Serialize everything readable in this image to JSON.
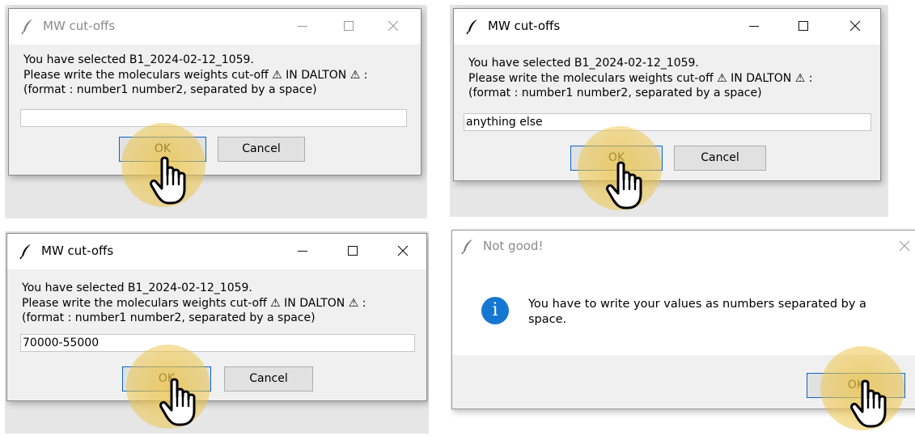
{
  "dialog_title": "MW cut-offs",
  "prompt": {
    "line1": "You have selected B1_2024-02-12_1059.",
    "line2": " Please write the moleculars weights cut-off ⚠ IN DALTON ⚠ :",
    "line3": "(format : number1 number2, separated by a space)"
  },
  "ok_label": "OK",
  "cancel_label": "Cancel",
  "panel1": {
    "entry_value": ""
  },
  "panel2": {
    "entry_value": "anything else"
  },
  "panel3": {
    "entry_value": "70000-55000"
  },
  "panel4": {
    "title": "Not good!",
    "message": "You have to write your values as numbers separated by a space.",
    "info_glyph": "i",
    "ok_label": "OK"
  },
  "icons": [
    "feather-icon",
    "minimize-icon",
    "maximize-icon",
    "close-icon",
    "info-icon",
    "hand-pointer-icon"
  ],
  "colors": {
    "highlight": "#ecc448",
    "info_blue": "#1677d2",
    "default_button_border": "#0a64c8"
  }
}
